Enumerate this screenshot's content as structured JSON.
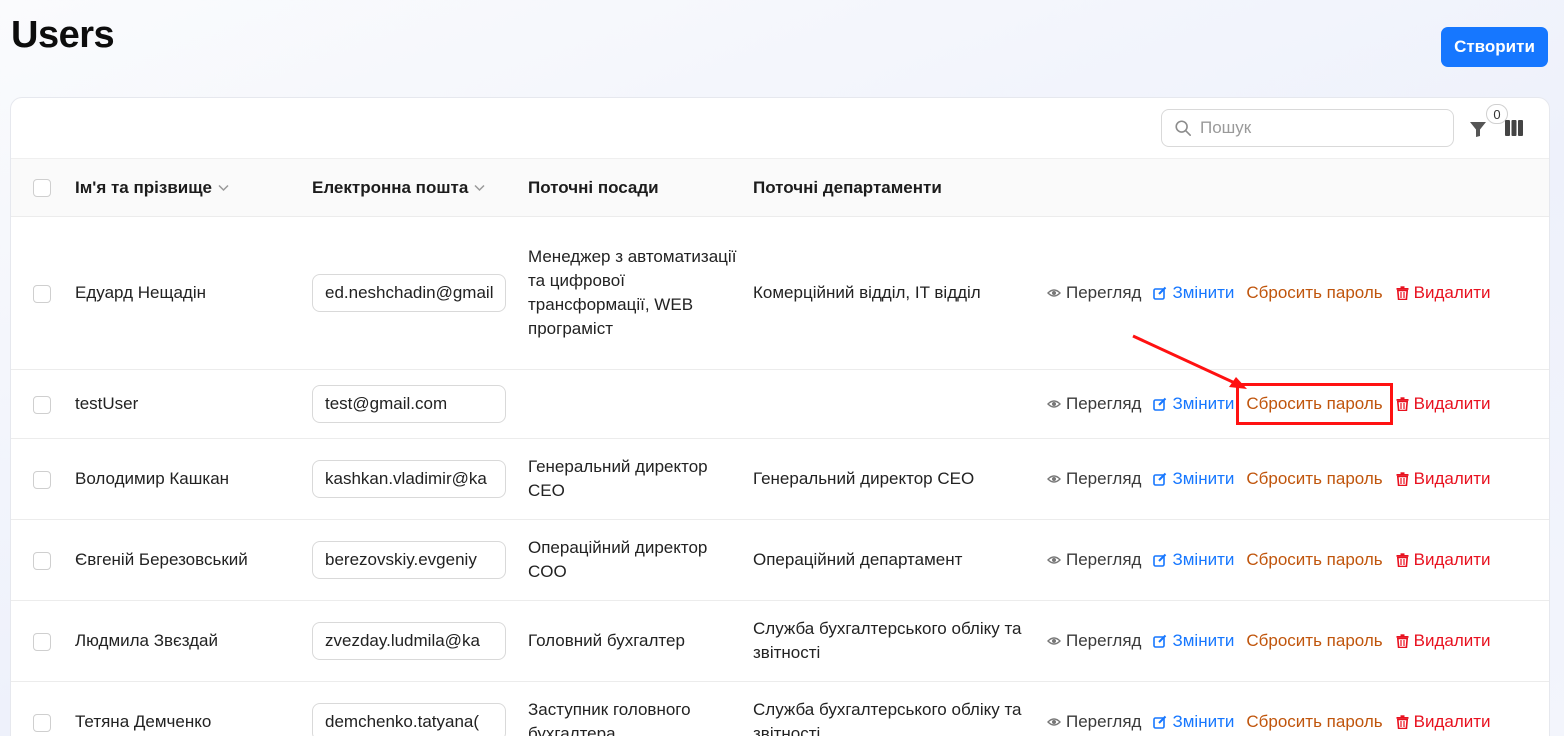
{
  "page": {
    "title": "Users"
  },
  "header": {
    "create_label": "Створити"
  },
  "toolbar": {
    "search_placeholder": "Пошук",
    "filter_count": "0"
  },
  "table": {
    "columns": [
      {
        "label": "Ім'я та прізвище",
        "sortable": true
      },
      {
        "label": "Електронна пошта",
        "sortable": true
      },
      {
        "label": "Поточні посади",
        "sortable": false
      },
      {
        "label": "Поточні департаменти",
        "sortable": false
      }
    ],
    "action_labels": {
      "view": "Перегляд",
      "edit": "Змінити",
      "reset": "Сбросить пароль",
      "delete": "Видалити"
    },
    "rows": [
      {
        "name": "Едуард Нещадін",
        "email": "ed.neshchadin@gmail.com",
        "position": "Менеджер з автоматизації та цифрової трансформації, WEB програміст",
        "department": "Комерційний відділ, IT відділ"
      },
      {
        "name": "testUser",
        "email": "test@gmail.com",
        "position": "",
        "department": ""
      },
      {
        "name": "Володимир Кашкан",
        "email": "kashkan.vladimir@ka",
        "position": "Генеральний директор CEO",
        "department": "Генеральний директор CEO"
      },
      {
        "name": "Євгеній Березовський",
        "email": "berezovskiy.evgeniy",
        "position": "Операційний директор COO",
        "department": "Операційний департамент"
      },
      {
        "name": "Людмила Звєздай",
        "email": "zvezday.ludmila@ka",
        "position": "Головний бухгалтер",
        "department": "Служба бухгалтерського обліку та звітності"
      },
      {
        "name": "Тетяна Демченко",
        "email": "demchenko.tatyana(",
        "position": "Заступник головного бухгалтера",
        "department": "Служба бухгалтерського обліку та звітності"
      }
    ]
  },
  "annotation": {
    "highlight_color": "#ff1111",
    "highlighted_row_index": 1
  }
}
